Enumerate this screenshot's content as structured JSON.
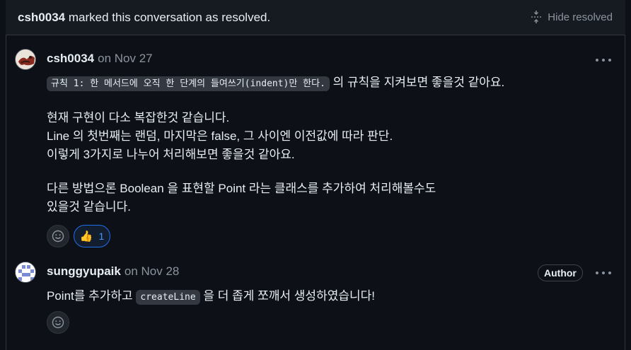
{
  "resolved_banner": {
    "user": "csh0034",
    "text": "marked this conversation as resolved.",
    "hide_label": "Hide resolved"
  },
  "comments": [
    {
      "username": "csh0034",
      "date": "on Nov 27",
      "code": "규칙 1: 한 메서드에 오직 한 단계의 들여쓰기(indent)만 한다.",
      "after_code": " 의 규칙을 지켜보면 좋을것 같아요.",
      "para2_line1": "현재 구현이 다소 복잡한것 같습니다.",
      "para2_line2": "Line 의 첫번째는 랜덤, 마지막은 false, 그 사이엔 이전값에 따라 판단.",
      "para2_line3": "이렇게 3가지로 나누어 처리해보면 좋을것 같아요.",
      "para3_line1": "다른 방법으론 Boolean 을 표현할 Point 라는 클래스를 추가하여 처리해볼수도",
      "para3_line2": "있을것 같습니다.",
      "reaction_count": "1"
    },
    {
      "username": "sunggyupaik",
      "date": "on Nov 28",
      "badge": "Author",
      "before_code": "Point를 추가하고 ",
      "code": "createLine",
      "after_code": " 을 더 좁게 쪼깨서 생성하였습니다!"
    }
  ],
  "icons": {
    "unfold": "unfold-icon",
    "kebab": "kebab-horizontal-icon",
    "smiley": "smiley-icon",
    "thumbs_up": "thumbs-up-icon"
  },
  "colors": {
    "background": "#0d1117",
    "banner": "#161b22",
    "border": "#30363d",
    "text": "#e6edf3",
    "muted": "#8b949e",
    "accent": "#4493f8"
  }
}
